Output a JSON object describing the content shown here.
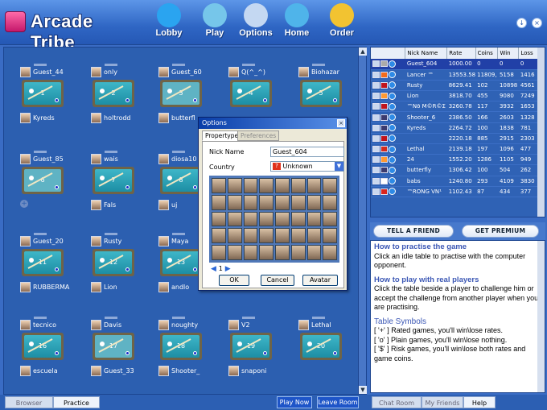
{
  "app": {
    "title": "Arcade Tribe"
  },
  "nav": [
    {
      "key": "lobby",
      "label": "Lobby",
      "icon": "lobby-runner-icon",
      "color": "#2aa4f0"
    },
    {
      "key": "play",
      "label": "Play",
      "icon": "gamepad-icon",
      "color": "#76c6ea"
    },
    {
      "key": "options",
      "label": "Options",
      "icon": "gears-icon",
      "color": "#c4d8f2"
    },
    {
      "key": "home",
      "label": "Home",
      "icon": "house-icon",
      "color": "#4fb4ea"
    },
    {
      "key": "order",
      "label": "Order",
      "icon": "coins-icon",
      "color": "#f2c331"
    }
  ],
  "window": {
    "minimize": "↓",
    "close": "×"
  },
  "tables": [
    {
      "num": "1",
      "top": "Guest_44",
      "bottom": "Kyreds",
      "idle": false
    },
    {
      "num": "2",
      "top": "only",
      "bottom": "holtrodd",
      "idle": false
    },
    {
      "num": "3",
      "top": "Guest_60",
      "bottom": "butterfl",
      "idle": true
    },
    {
      "num": "4",
      "top": "Q(^_^)",
      "bottom": "",
      "idle": false
    },
    {
      "num": "5",
      "top": "Biohazar",
      "bottom": "",
      "idle": false
    },
    {
      "num": "6",
      "top": "Guest_85",
      "bottom": "",
      "idle": true
    },
    {
      "num": "7",
      "top": "wais",
      "bottom": "Fals",
      "idle": false
    },
    {
      "num": "8",
      "top": "diosa10",
      "bottom": "uj",
      "idle": false
    },
    {
      "num": "11",
      "top": "Guest_20",
      "bottom": "RUBBERMA",
      "idle": false
    },
    {
      "num": "12",
      "top": "Rusty",
      "bottom": "Lion",
      "idle": false
    },
    {
      "num": "13",
      "top": "Maya",
      "bottom": "andlo",
      "idle": false
    },
    {
      "num": "16",
      "top": "tecnico",
      "bottom": "escuela",
      "idle": false
    },
    {
      "num": "17",
      "top": "Davis",
      "bottom": "Guest_33",
      "idle": true
    },
    {
      "num": "18",
      "top": "noughty",
      "bottom": "Shooter_",
      "idle": false
    },
    {
      "num": "19",
      "top": "V2",
      "bottom": "snaponi",
      "idle": false
    },
    {
      "num": "20",
      "top": "Lethal",
      "bottom": "",
      "idle": false
    }
  ],
  "ranking": {
    "headers": [
      "",
      "Nick Name",
      "Rate",
      "Coins",
      "Win",
      "Loss"
    ],
    "rows": [
      {
        "flag": "#aaaaaa",
        "name": "Guest_604",
        "rate": "1000.00",
        "coins": "0",
        "win": "0",
        "loss": "0",
        "sel": true
      },
      {
        "flag": "#f26b1d",
        "name": "Lancer ™",
        "rate": "13553.58",
        "coins": "11809,",
        "win": "5158",
        "loss": "1416"
      },
      {
        "flag": "#c0141d",
        "name": "Rusty",
        "rate": "8629.41",
        "coins": "102",
        "win": "10898",
        "loss": "4561"
      },
      {
        "flag": "#ff9933",
        "name": "Lion",
        "rate": "3818.70",
        "coins": "455",
        "win": "9080",
        "loss": "7249"
      },
      {
        "flag": "#c0141d",
        "name": "™Nō M©R©Σ",
        "rate": "3260.78",
        "coins": "117",
        "win": "3932",
        "loss": "1653"
      },
      {
        "flag": "#3c3b6e",
        "name": "Shooter_6",
        "rate": "2386.50",
        "coins": "166",
        "win": "2603",
        "loss": "1328"
      },
      {
        "flag": "#3c3b6e",
        "name": "Kyreds",
        "rate": "2264.72",
        "coins": "100",
        "win": "1838",
        "loss": "781"
      },
      {
        "flag": "#c0141d",
        "name": "",
        "rate": "2220.18",
        "coins": "885",
        "win": "2915",
        "loss": "2303"
      },
      {
        "flag": "#d52b1e",
        "name": "Lethal",
        "rate": "2139.18",
        "coins": "197",
        "win": "1096",
        "loss": "477"
      },
      {
        "flag": "#ff9933",
        "name": "24",
        "rate": "1552.20",
        "coins": "1286",
        "win": "1105",
        "loss": "949"
      },
      {
        "flag": "#3c3b6e",
        "name": "butterfly",
        "rate": "1306.42",
        "coins": "100",
        "win": "504",
        "loss": "262"
      },
      {
        "flag": "#ffffff",
        "name": "babs",
        "rate": "1240.80",
        "coins": "293",
        "win": "4109",
        "loss": "3830"
      },
      {
        "flag": "#da251d",
        "name": "™RONG VN¹",
        "rate": "1102.43",
        "coins": "87",
        "win": "434",
        "loss": "377"
      }
    ]
  },
  "promo": {
    "tell": "Tell a Friend",
    "premium": "Get Premium"
  },
  "help": {
    "h1": "How to practise the game",
    "p1": "Click an idle table to practise with the computer opponent.",
    "h2": "How to play with real players",
    "p2": "Click the table beside a player to challenge him or accept the challenge from another player when you are practising.",
    "h3": "Table Symbols",
    "s1": "[ '+' ]    Rated games, you'll win\\lose rates.",
    "s2": "[ 'o' ]    Plain games, you'll win\\lose nothing.",
    "s3": "[ '$' ]    Risk games, you'll win\\lose both rates and game coins."
  },
  "dialog": {
    "title": "Options",
    "close": "×",
    "tab1": "Propertype",
    "tab2": "Preferences",
    "nick_label": "Nick Name",
    "nick_value": "Guest_604",
    "country_label": "Country",
    "country_value": "Unknown",
    "page": "1",
    "ok": "OK",
    "cancel": "Cancel",
    "avatar": "Avatar"
  },
  "tabs": {
    "browser": "Browser",
    "practice": "Practice",
    "chat": "Chat Room",
    "friends": "My Friends",
    "help": "Help"
  },
  "actions": {
    "play_now": "Play Now",
    "leave_room": "Leave Room"
  }
}
